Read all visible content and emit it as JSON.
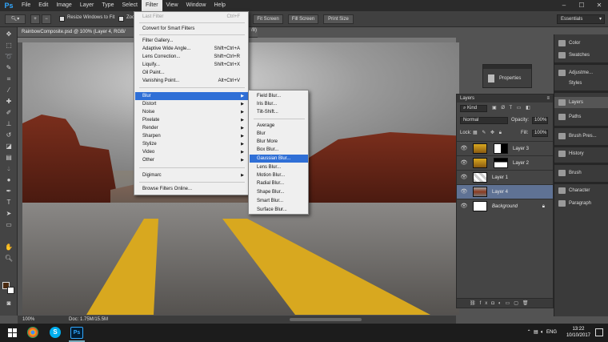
{
  "app": {
    "logo": "Ps"
  },
  "menubar": {
    "items": [
      "File",
      "Edit",
      "Image",
      "Layer",
      "Type",
      "Select",
      "Filter",
      "View",
      "Window",
      "Help"
    ],
    "active": "Filter"
  },
  "options": {
    "resize_label": "Resize Windows to Fit",
    "zoom_label": "Zoo",
    "fit_screen": "Fit Screen",
    "fill_screen": "Fill Screen",
    "print_size": "Print Size",
    "workspace": "Essentials"
  },
  "document": {
    "tab_title": "RainbowComposite.psd @ 100% (Layer 4, RGB/",
    "tab_suffix": "/8)",
    "zoom": "100%",
    "doc_info": "Doc: 1.75M/15.5M"
  },
  "filter_menu": {
    "last_filter": {
      "label": "Last Filter",
      "shortcut": "Ctrl+F"
    },
    "convert": "Convert for Smart Filters",
    "items_group1": [
      {
        "label": "Filter Gallery...",
        "shortcut": ""
      },
      {
        "label": "Adaptive Wide Angle...",
        "shortcut": "Shift+Ctrl+A"
      },
      {
        "label": "Lens Correction...",
        "shortcut": "Shift+Ctrl+R"
      },
      {
        "label": "Liquify...",
        "shortcut": "Shift+Ctrl+X"
      },
      {
        "label": "Oil Paint...",
        "shortcut": ""
      },
      {
        "label": "Vanishing Point...",
        "shortcut": "Alt+Ctrl+V"
      }
    ],
    "submenus": [
      "Blur",
      "Distort",
      "Noise",
      "Pixelate",
      "Render",
      "Sharpen",
      "Stylize",
      "Video",
      "Other"
    ],
    "digimarc": "Digimarc",
    "browse": "Browse Filters Online..."
  },
  "blur_menu": {
    "group1": [
      "Field Blur...",
      "Iris Blur...",
      "Tilt-Shift..."
    ],
    "group2": [
      "Average",
      "Blur",
      "Blur More",
      "Box Blur...",
      "Gaussian Blur...",
      "Lens Blur...",
      "Motion Blur...",
      "Radial Blur...",
      "Shape Blur...",
      "Smart Blur...",
      "Surface Blur..."
    ],
    "highlighted": "Gaussian Blur..."
  },
  "properties_panel": {
    "label": "Properties"
  },
  "layers_panel": {
    "title": "Layers",
    "kind": "Kind",
    "blend_mode": "Normal",
    "opacity_label": "Opacity:",
    "opacity": "100%",
    "lock_label": "Lock:",
    "fill_label": "Fill:",
    "fill": "100%",
    "layers": [
      "Layer 3",
      "Layer 2",
      "Layer 1",
      "Layer 4",
      "Background"
    ],
    "selected": "Layer 4"
  },
  "right_dock": {
    "items": [
      "Color",
      "Swatches",
      "Adjustme...",
      "Styles",
      "Layers",
      "Paths",
      "Brush Pres...",
      "History",
      "Brush",
      "Character",
      "Paragraph"
    ],
    "selected": "Layers"
  },
  "taskbar": {
    "language": "ENG",
    "time": "13:22",
    "date": "10/10/2017"
  },
  "colors": {
    "menu_highlight": "#2f6fd6",
    "layer_selected": "#5f7294",
    "ps_blue": "#31a8ff"
  }
}
